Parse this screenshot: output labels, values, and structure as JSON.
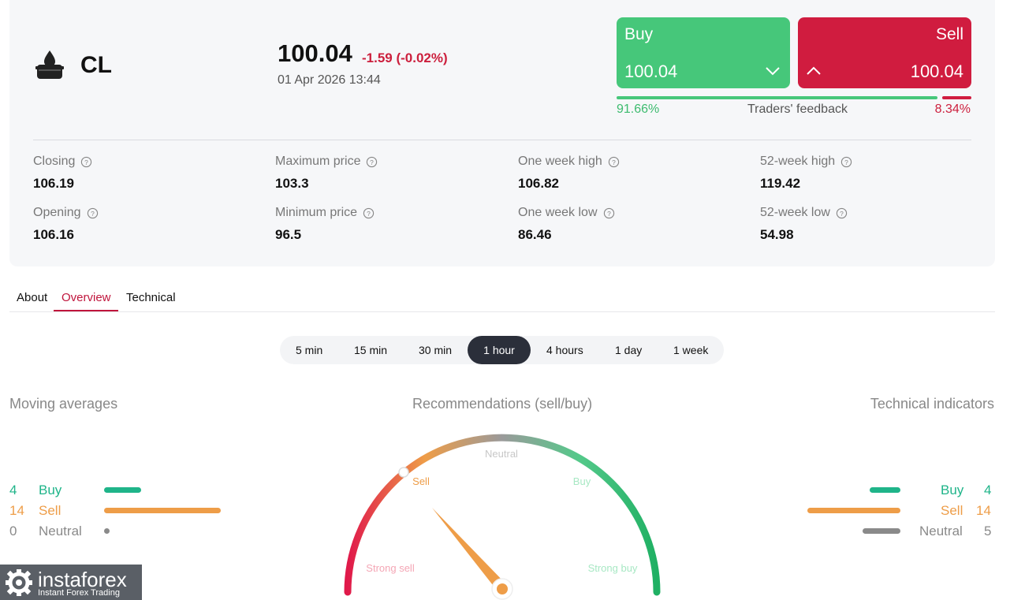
{
  "header": {
    "symbol": "CL",
    "price": "100.04",
    "change": "-1.59 (-0.02%)",
    "datetime": "01 Apr 2026 13:44",
    "buy_label": "Buy",
    "buy_price": "100.04",
    "sell_label": "Sell",
    "sell_price": "100.04",
    "feedback": {
      "buy_pct": "91.66%",
      "title": "Traders' feedback",
      "sell_pct": "8.34%",
      "buy_fraction": 0.9166
    }
  },
  "stats": [
    {
      "label": "Closing",
      "value": "106.19"
    },
    {
      "label": "Opening",
      "value": "106.16"
    },
    {
      "label": "Maximum price",
      "value": "103.3"
    },
    {
      "label": "Minimum price",
      "value": "96.5"
    },
    {
      "label": "One week high",
      "value": "106.82"
    },
    {
      "label": "One week low",
      "value": "86.46"
    },
    {
      "label": "52-week high",
      "value": "119.42"
    },
    {
      "label": "52-week low",
      "value": "54.98"
    }
  ],
  "tabs": [
    "About",
    "Overview",
    "Technical"
  ],
  "active_tab": "Overview",
  "periods": [
    "5 min",
    "15 min",
    "30 min",
    "1 hour",
    "4 hours",
    "1 day",
    "1 week"
  ],
  "active_period": "1 hour",
  "moving_averages": {
    "title": "Moving averages",
    "rows": [
      {
        "count": "4",
        "label": "Buy",
        "color": "#1fb489"
      },
      {
        "count": "14",
        "label": "Sell",
        "color": "#ee9d48"
      },
      {
        "count": "0",
        "label": "Neutral",
        "color": "#8a8a8a"
      }
    ]
  },
  "recommendations": {
    "title": "Recommendations (sell/buy)",
    "labels": {
      "strong_sell": "Strong sell",
      "sell": "Sell",
      "neutral": "Neutral",
      "buy": "Buy",
      "strong_buy": "Strong buy"
    },
    "signal": "Sell"
  },
  "technical_indicators": {
    "title": "Technical indicators",
    "rows": [
      {
        "count": "4",
        "label": "Buy",
        "color": "#1fb489"
      },
      {
        "count": "14",
        "label": "Sell",
        "color": "#ee9d48"
      },
      {
        "count": "5",
        "label": "Neutral",
        "color": "#8a8a8a"
      }
    ]
  },
  "brand": {
    "name": "instaforex",
    "tagline": "Instant Forex Trading"
  },
  "colors": {
    "buy": "#46c77a",
    "sell": "#d01c3f",
    "accent": "#c0153c"
  }
}
